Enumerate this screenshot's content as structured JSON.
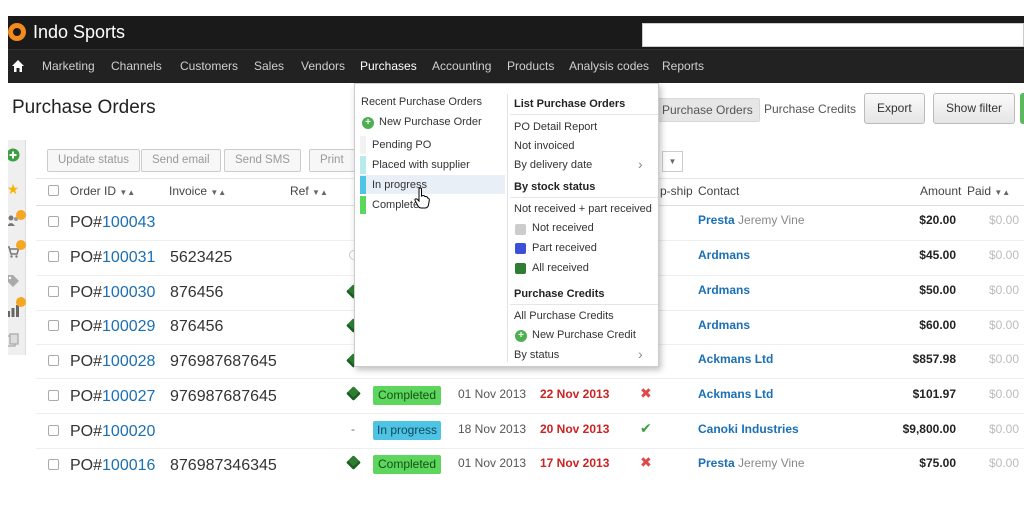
{
  "app": {
    "name": "Indo Sports"
  },
  "nav": [
    "Marketing",
    "Channels",
    "Customers",
    "Sales",
    "Vendors",
    "Purchases",
    "Accounting",
    "Products",
    "Analysis codes",
    "Reports"
  ],
  "page": {
    "title": "Purchase Orders",
    "tabs": [
      "Purchase Orders",
      "Purchase Credits"
    ],
    "export_label": "Export",
    "filter_label": "Show filter"
  },
  "toolbar": [
    "Update status",
    "Send email",
    "Send SMS",
    "Print"
  ],
  "table": {
    "headers": {
      "order_id": "Order ID",
      "invoice": "Invoice",
      "ref": "Ref",
      "dropship": "p-ship",
      "contact": "Contact",
      "amount": "Amount",
      "paid": "Paid"
    },
    "rows": [
      {
        "prefix": "PO#",
        "num": "100043",
        "invoice": "",
        "status": "",
        "date1": "",
        "date2": "",
        "mark": "",
        "contact": "Presta",
        "person": "Jeremy Vine",
        "amount": "$20.00",
        "paid": "$0.00"
      },
      {
        "prefix": "PO#",
        "num": "100031",
        "invoice": "5623425",
        "status": "",
        "date1": "",
        "date2": "",
        "mark": "",
        "contact": "Ardmans",
        "person": "",
        "amount": "$45.00",
        "paid": "$0.00"
      },
      {
        "prefix": "PO#",
        "num": "100030",
        "invoice": "876456",
        "status": "",
        "date1": "",
        "date2": "",
        "mark": "",
        "contact": "Ardmans",
        "person": "",
        "amount": "$50.00",
        "paid": "$0.00"
      },
      {
        "prefix": "PO#",
        "num": "100029",
        "invoice": "876456",
        "status": "",
        "date1": "",
        "date2": "",
        "mark": "",
        "contact": "Ardmans",
        "person": "",
        "amount": "$60.00",
        "paid": "$0.00"
      },
      {
        "prefix": "PO#",
        "num": "100028",
        "invoice": "976987687645",
        "status": "",
        "date1": "",
        "date2": "",
        "mark": "",
        "contact": "Ackmans Ltd",
        "person": "",
        "amount": "$857.98",
        "paid": "$0.00"
      },
      {
        "prefix": "PO#",
        "num": "100027",
        "invoice": "976987687645",
        "status": "Completed",
        "date1": "01 Nov 2013",
        "date2": "22 Nov 2013",
        "mark": "✖",
        "contact": "Ackmans Ltd",
        "person": "",
        "amount": "$101.97",
        "paid": "$0.00"
      },
      {
        "prefix": "PO#",
        "num": "100020",
        "invoice": "",
        "status": "In progress",
        "date1": "18 Nov 2013",
        "date2": "20 Nov 2013",
        "mark": "✔",
        "contact": "Canoki Industries",
        "person": "",
        "amount": "$9,800.00",
        "paid": "$0.00"
      },
      {
        "prefix": "PO#",
        "num": "100016",
        "invoice": "876987346345",
        "status": "Completed",
        "date1": "01 Nov 2013",
        "date2": "17 Nov 2013",
        "mark": "✖",
        "contact": "Presta",
        "person": "Jeremy Vine",
        "amount": "$75.00",
        "paid": "$0.00"
      }
    ]
  },
  "menu": {
    "recent": "Recent Purchase Orders",
    "new_po": "New Purchase Order",
    "po_statuses": [
      "Pending PO",
      "Placed with supplier",
      "In progress",
      "Completed"
    ],
    "list_head": "List Purchase Orders",
    "list_items": [
      "PO Detail Report",
      "Not invoiced",
      "By delivery date"
    ],
    "stock_head": "By stock status",
    "stock_items": [
      "Not received + part received",
      "Not received",
      "Part received",
      "All received"
    ],
    "credits_head": "Purchase Credits",
    "credit_items": [
      "All Purchase Credits",
      "New Purchase Credit",
      "By status"
    ]
  },
  "colors": {
    "completed": "#5cd65c",
    "in_progress": "#4fc3e3",
    "link": "#1a6fb5",
    "late_date": "#cc2222"
  }
}
